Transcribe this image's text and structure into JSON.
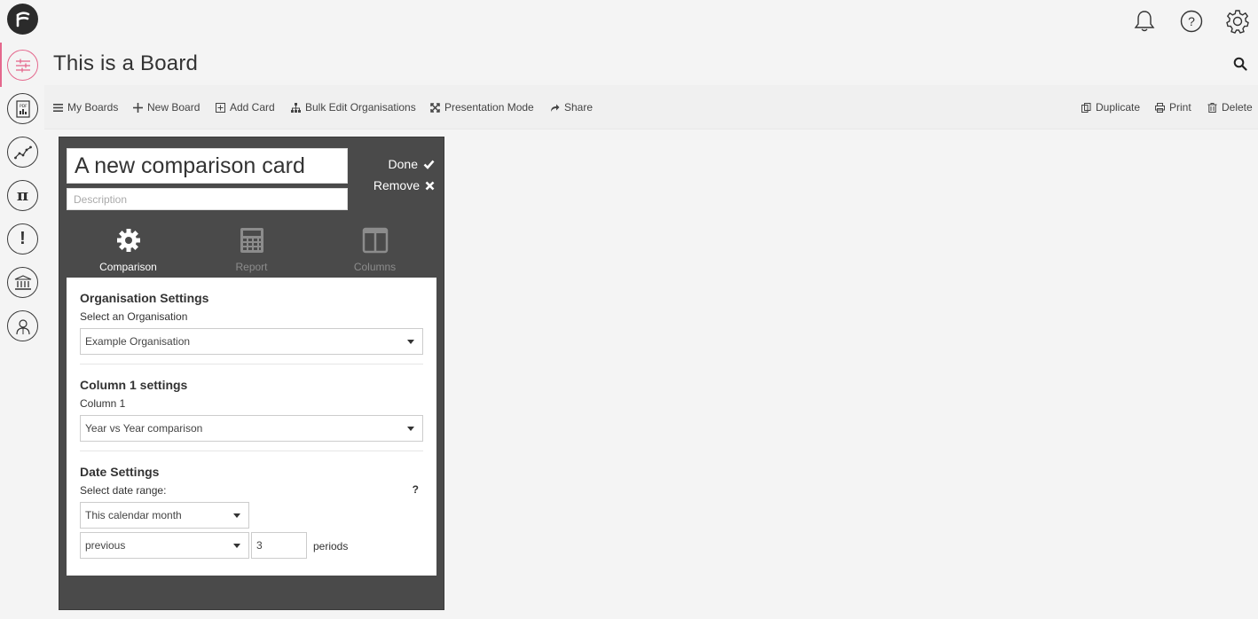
{
  "header": {
    "title": "This is a Board"
  },
  "sidebar": {
    "items": [
      {
        "icon": "sliders-icon",
        "active": true
      },
      {
        "icon": "pdf-report-icon",
        "active": false
      },
      {
        "icon": "line-chart-icon",
        "active": false
      },
      {
        "icon": "pi-icon",
        "active": false
      },
      {
        "icon": "alert-icon",
        "active": false
      },
      {
        "icon": "bank-icon",
        "active": false
      },
      {
        "icon": "user-icon",
        "active": false
      }
    ]
  },
  "toolbar": {
    "my_boards": "My Boards",
    "new_board": "New Board",
    "add_card": "Add Card",
    "bulk_edit": "Bulk Edit Organisations",
    "presentation": "Presentation Mode",
    "share": "Share",
    "duplicate": "Duplicate",
    "print": "Print",
    "delete": "Delete"
  },
  "card": {
    "title": "A new comparison card",
    "description_placeholder": "Description",
    "done_label": "Done",
    "remove_label": "Remove",
    "tabs": [
      {
        "label": "Comparison",
        "active": true
      },
      {
        "label": "Report",
        "active": false
      },
      {
        "label": "Columns",
        "active": false
      }
    ],
    "org_settings": {
      "title": "Organisation Settings",
      "label": "Select an Organisation",
      "value": "Example Organisation"
    },
    "column_settings": {
      "title": "Column 1 settings",
      "label": "Column 1",
      "value": "Year vs Year comparison"
    },
    "date_settings": {
      "title": "Date Settings",
      "label": "Select date range:",
      "help": "?",
      "range_value": "This calendar month",
      "mode_value": "previous",
      "periods_value": "3",
      "periods_label": "periods"
    }
  },
  "colors": {
    "accent": "#e4688d",
    "card_bg": "#4a4a4a"
  }
}
